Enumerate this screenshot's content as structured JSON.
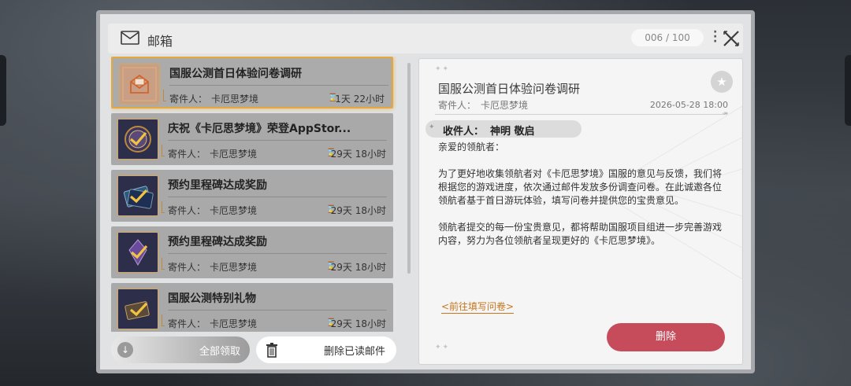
{
  "header": {
    "title": "邮箱",
    "count": "006 / 100"
  },
  "mails": [
    {
      "title": "国服公测首日体验问卷调研",
      "sender_label": "寄件人：",
      "sender": "卡厄思梦境",
      "time": "1天 22小时",
      "icon": "envelope-icon",
      "selected": true
    },
    {
      "title": "庆祝《卡厄思梦境》荣登AppStor...",
      "sender_label": "寄件人：",
      "sender": "卡厄思梦境",
      "time": "29天 18小时",
      "icon": "reward-emblem-icon",
      "selected": false
    },
    {
      "title": "预约里程碑达成奖励",
      "sender_label": "寄件人：",
      "sender": "卡厄思梦境",
      "time": "29天 18小时",
      "icon": "reward-card-icon",
      "selected": false
    },
    {
      "title": "预约里程碑达成奖励",
      "sender_label": "寄件人：",
      "sender": "卡厄思梦境",
      "time": "29天 18小时",
      "icon": "reward-crystal-icon",
      "selected": false
    },
    {
      "title": "国服公测特别礼物",
      "sender_label": "寄件人：",
      "sender": "卡厄思梦境",
      "time": "29天 18小时",
      "icon": "reward-gift-icon",
      "selected": false
    }
  ],
  "footer": {
    "claim_all": "全部领取",
    "delete_read": "删除已读邮件"
  },
  "detail": {
    "title": "国服公测首日体验问卷调研",
    "sender_label": "寄件人：",
    "sender": "卡厄思梦境",
    "date": "2026-05-28 18:00",
    "recipient_label": "收件人：",
    "recipient_name": "神明 敬启",
    "body": "亲爱的领航者：\n\n为了更好地收集领航者对《卡厄思梦境》国服的意见与反馈，我们将根据您的游戏进度，依次通过邮件发放多份调查问卷。在此诚邀各位领航者基于首日游玩体验，填写问卷并提供您的宝贵意见。\n\n领航者提交的每一份宝贵意见，都将帮助国服项目组进一步完善游戏内容，努力为各位领航者呈现更好的《卡厄思梦境》。",
    "link": "<前往填写问卷>",
    "delete": "删除"
  },
  "colors": {
    "accent_gold": "#e6a83a",
    "delete_red": "#c64b5b",
    "link_orange": "#c8741a"
  }
}
